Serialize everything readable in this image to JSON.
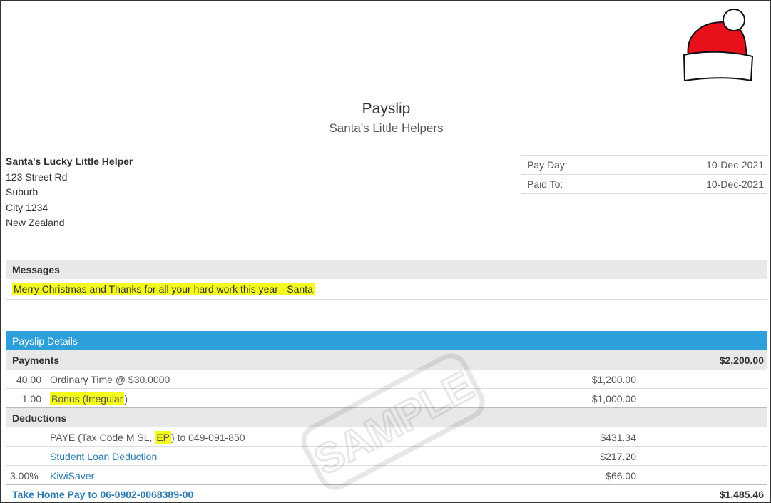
{
  "document": {
    "title": "Payslip",
    "company": "Santa's Little Helpers",
    "watermark": "SAMPLE"
  },
  "employee": {
    "name": "Santa's Lucky Little Helper",
    "address_lines": [
      "123 Street Rd",
      "Suburb",
      "City 1234",
      "New Zealand"
    ]
  },
  "pay_info": [
    {
      "label": "Pay Day:",
      "value": "10-Dec-2021"
    },
    {
      "label": "Paid To:",
      "value": "10-Dec-2021"
    }
  ],
  "messages": {
    "header": "Messages",
    "text": "Merry Christmas and Thanks for all your hard work this year - Santa"
  },
  "details": {
    "header": "Payslip Details",
    "payments": {
      "label": "Payments",
      "total": "$2,200.00",
      "lines": [
        {
          "qty": "40.00",
          "desc": "Ordinary Time @ $30.0000",
          "amount": "$1,200.00"
        },
        {
          "qty": "1.00",
          "desc_highlight": "Bonus (Irregular",
          "desc_suffix": ")",
          "amount": "$1,000.00"
        }
      ]
    },
    "deductions": {
      "label": "Deductions",
      "lines": [
        {
          "qty": "",
          "desc_prefix": "PAYE (Tax Code M SL, ",
          "desc_highlight": "EP",
          "desc_suffix": ") to 049-091-850",
          "amount": "$431.34"
        },
        {
          "qty": "",
          "desc": "Student Loan Deduction",
          "amount": "$217.20"
        },
        {
          "qty": "3.00%",
          "desc": "KiwiSaver",
          "amount": "$66.00"
        }
      ]
    },
    "take_home": {
      "label": "Take Home Pay to 06-0902-0068389-00",
      "amount": "$1,485.46"
    }
  },
  "colors": {
    "accent_blue": "#2d9fdb",
    "link_blue": "#2a7ab0",
    "highlight_yellow": "#f5fa1e",
    "hat_red": "#e8101a"
  }
}
